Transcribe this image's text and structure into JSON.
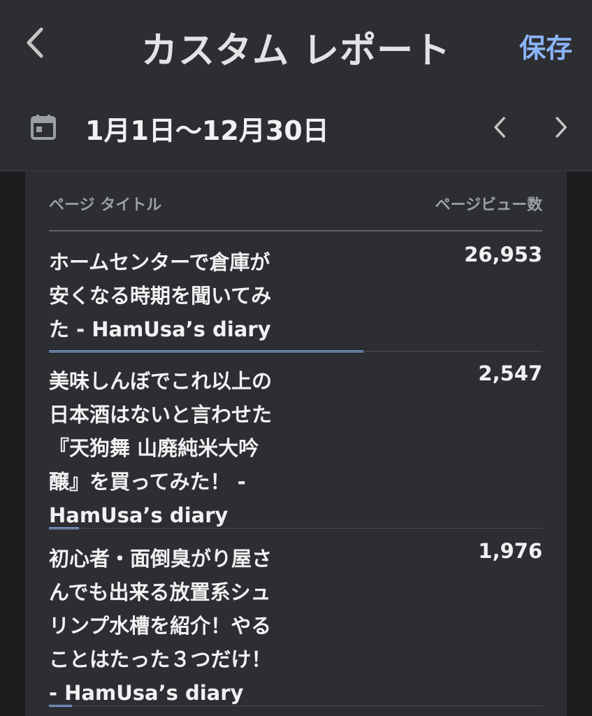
{
  "header": {
    "title": "カスタム レポート",
    "save_label": "保存",
    "date_range": "1月1日〜12月30日"
  },
  "table": {
    "columns": [
      "ページ タイトル",
      "ページビュー数"
    ],
    "rows": [
      {
        "title": "ホームセンターで倉庫が\n安くなる時期を聞いてみ\nた - HamUsa’s diary",
        "views": "26,953",
        "share": 1.0
      },
      {
        "title": "美味しんぼでこれ以上の\n日本酒はないと言わせた\n『天狗舞 山廃純米大吟\n醸』を買ってみた！ -\nHamUsa’s diary",
        "views": "2,547",
        "share": 0.0945
      },
      {
        "title": "初心者・面倒臭がり屋さ\nんでも出来る放置系シュ\nリンプ水槽を紹介！やる\nことはたった３つだけ！\n- HamUsa’s diary",
        "views": "1,976",
        "share": 0.0733
      }
    ]
  },
  "colors": {
    "accent": "#8ab4f8",
    "surface": "#2d2e31",
    "background": "#1f2023"
  },
  "icons": {
    "back": "chevron-left-icon",
    "calendar": "calendar-icon",
    "prev": "chevron-left-icon",
    "next": "chevron-right-icon"
  }
}
